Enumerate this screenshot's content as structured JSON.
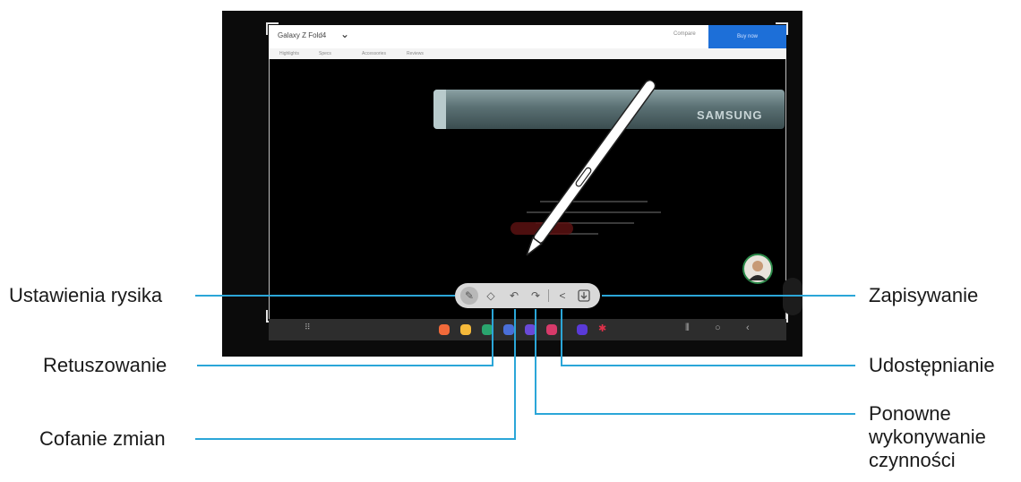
{
  "browser": {
    "title": "Galaxy Z Fold4",
    "action_text": "Compare",
    "button_label": "Buy now",
    "tabs": [
      "Highlights",
      "Specs",
      "Accessories",
      "Reviews"
    ]
  },
  "product": {
    "brand": "SAMSUNG"
  },
  "toolbar": {
    "icons": [
      "pen-settings-icon",
      "eraser-icon",
      "undo-icon",
      "redo-icon",
      "share-icon",
      "save-icon"
    ]
  },
  "callouts": {
    "pen_settings": "Ustawienia rysika",
    "retouch": "Retuszowanie",
    "undo": "Cofanie zmian",
    "save": "Zapisywanie",
    "share": "Udostępnianie",
    "redo_line1": "Ponowne",
    "redo_line2": "wykonywanie",
    "redo_line3": "czynności"
  },
  "colors": {
    "leader": "#2ba6d8",
    "toolbar": "#d9d9d9",
    "accent": "#1d6fd8"
  }
}
